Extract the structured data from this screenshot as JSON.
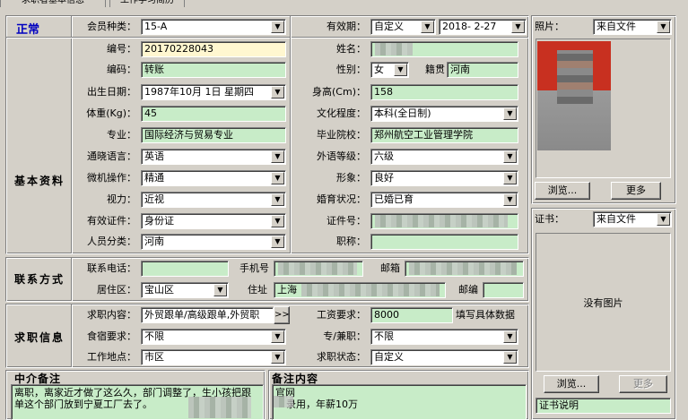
{
  "tabs": [
    "求职者基本信息",
    "工作学习简历"
  ],
  "status": "正常",
  "sections": {
    "basic": "基本资料",
    "contact": "联系方式",
    "job": "求职信息",
    "agency_notes": "中介备注",
    "notes": "备注内容"
  },
  "basic": {
    "member_type_label": "会员种类：",
    "member_type": "15-A",
    "validity_label": "有效期：",
    "validity_type": "自定义",
    "validity_date": "2018- 2-27",
    "number_label": "编号：",
    "number": "20170228043",
    "name_label": "姓名：",
    "code_label": "编码：",
    "code": "转账",
    "gender_label": "性别：",
    "gender": "女",
    "origin_label": "籍贯",
    "origin": "河南",
    "birth_label": "出生日期：",
    "birth": "1987年10月 1日 星期四",
    "height_label": "身高(Cm)：",
    "height": "158",
    "weight_label": "体重(Kg)：",
    "weight": "45",
    "education_label": "文化程度：",
    "education": "本科(全日制)",
    "major_label": "专业：",
    "major": "国际经济与贸易专业",
    "school_label": "毕业院校：",
    "school": "郑州航空工业管理学院",
    "language_label": "通晓语言：",
    "language": "英语",
    "lang_level_label": "外语等级：",
    "lang_level": "六级",
    "computer_label": "微机操作：",
    "computer": "精通",
    "appearance_label": "形象：",
    "appearance": "良好",
    "vision_label": "视力：",
    "vision": "近视",
    "marital_label": "婚育状况：",
    "marital": "已婚已育",
    "id_type_label": "有效证件：",
    "id_type": "身份证",
    "id_number_label": "证件号：",
    "category_label": "人员分类：",
    "category": "河南",
    "title_label": "职称："
  },
  "contact": {
    "phone_label": "联系电话：",
    "mobile_label": "手机号",
    "email_label": "邮箱",
    "district_label": "居住区：",
    "district": "宝山区",
    "address_label": "住址",
    "address": "上海",
    "zip_label": "邮编"
  },
  "job": {
    "content_label": "求职内容：",
    "content": "外贸跟单/高级跟单,外贸职",
    "more_btn": ">>",
    "salary_label": "工资要求：",
    "salary": "8000",
    "salary_note": "填写具体数据",
    "lodging_label": "食宿要求：",
    "lodging": "不限",
    "parttime_label": "专/兼职：",
    "parttime": "不限",
    "location_label": "工作地点：",
    "location": "市区",
    "state_label": "求职状态：",
    "state": "自定义"
  },
  "notes": {
    "agency_text": "离职，离家近才做了这么久，部门调整了，生小孩把跟单这个部门放到宁夏工厂去了。",
    "remark_line1": "官网",
    "remark_line2": "录用，年薪10万"
  },
  "photo": {
    "label": "照片：",
    "source": "来自文件",
    "browse": "浏览...",
    "more": "更多"
  },
  "cert": {
    "label": "证书：",
    "source": "来自文件",
    "no_image": "没有图片",
    "browse": "浏览...",
    "more": "更多",
    "description": "证书说明"
  }
}
